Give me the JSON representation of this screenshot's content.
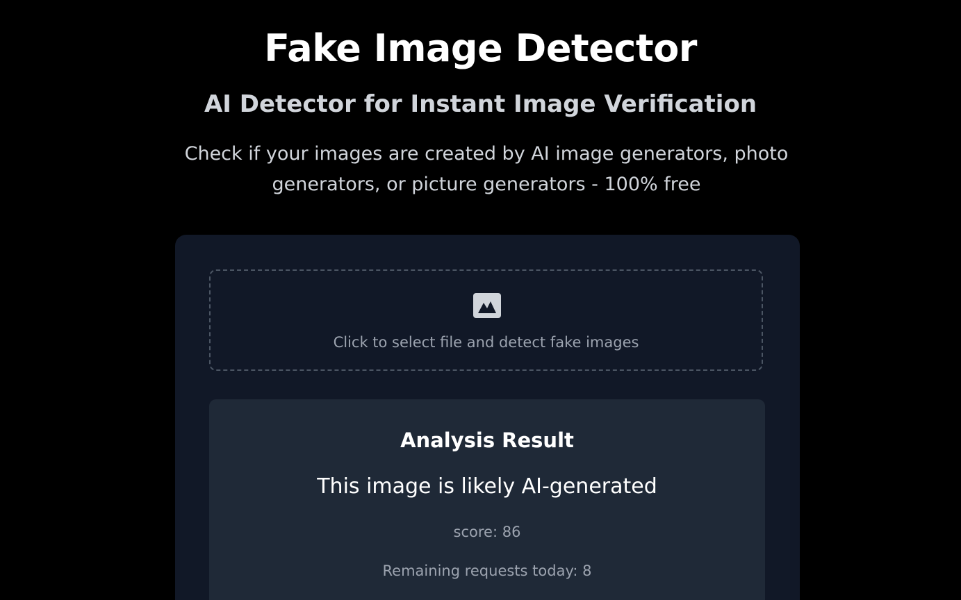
{
  "header": {
    "title": "Fake Image Detector",
    "subtitle": "AI Detector for Instant Image Verification",
    "description": "Check if your images are created by AI image generators, photo generators, or picture generators - 100% free"
  },
  "upload": {
    "icon": "image-icon",
    "prompt": "Click to select file and detect fake images"
  },
  "result": {
    "heading": "Analysis Result",
    "verdict": "This image is likely AI-generated",
    "score_text": "score: 86",
    "remaining_text": "Remaining requests today: 8"
  },
  "colors": {
    "background": "#000000",
    "card": "#111827",
    "result_panel": "#1f2937",
    "muted_text": "#9ca3af",
    "dashed_border": "#4b5563"
  }
}
